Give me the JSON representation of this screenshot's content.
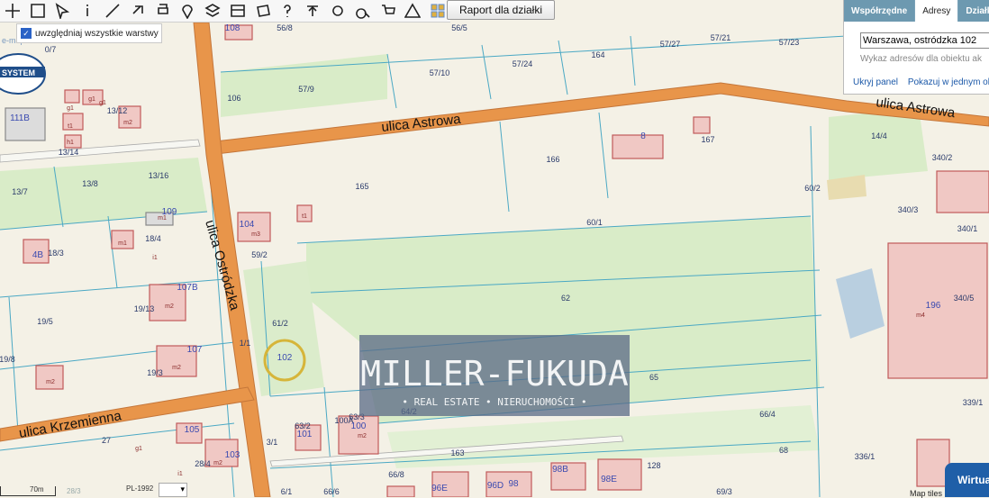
{
  "toolbar": {
    "tools": [
      "pan-icon",
      "zoom-extent-icon",
      "select-icon",
      "info-icon",
      "measure-icon",
      "link-icon",
      "print-icon",
      "location-pin-icon",
      "layers-icon",
      "layout-icon",
      "shape-icon",
      "help-icon",
      "upload-icon",
      "settings-icon",
      "search-map-icon",
      "cart-icon",
      "warning-icon",
      "color-grid-icon"
    ]
  },
  "report_button": "Raport dla działki",
  "layers_toggle": {
    "label": "uwzględniaj wszystkie warstwy",
    "checked": true
  },
  "side_panel": {
    "tabs": [
      "Współrzędne",
      "Adresy",
      "Działki"
    ],
    "active_tab": "Adresy",
    "address_value": "Warszawa, ostródzka 102",
    "hint": "Wykaz adresów dla obiektu ak",
    "links": [
      "Ukryj panel",
      "Pokazuj w jednym ok"
    ]
  },
  "watermark": {
    "brand": "MILLER-FUKUDA",
    "tagline": "• REAL ESTATE • NIERUCHOMOŚCI •"
  },
  "streets": [
    "ulica Astrowa",
    "ulica Astrowa",
    "ulica Ostródzka",
    "ulica Krzemienna"
  ],
  "streets_top_left": "",
  "logo_text": "SYSTEM",
  "logo_sub": "e-mapa.net",
  "parcels": [
    "56/8",
    "56/5",
    "57/27",
    "57/21",
    "57/23",
    "57/9",
    "57/10",
    "57/24",
    "164",
    "106",
    "13/12",
    "13/14",
    "165",
    "166",
    "167",
    "14/4",
    "340/2",
    "13/7",
    "13/8",
    "13/16",
    "60/2",
    "340/3",
    "60/1",
    "340/1",
    "18/3",
    "18/4",
    "59/2",
    "19/5",
    "19/13",
    "62",
    "340/5",
    "61/2",
    "19/8",
    "19/3",
    "65",
    "64/2",
    "66/4",
    "339/1",
    "27",
    "63/2",
    "63/3",
    "100A",
    "163",
    "68",
    "336/1",
    "28/4",
    "66/8",
    "128",
    "69/3",
    "66/6",
    "0/7",
    "1/1",
    "3/1",
    "6/1"
  ],
  "buildings": [
    "108",
    "109",
    "104",
    "107B",
    "107",
    "105",
    "103",
    "101",
    "102",
    "100",
    "111B",
    "8",
    "4B",
    "196",
    "98B",
    "98E",
    "96E",
    "96D",
    "98"
  ],
  "building_codes": [
    "g1",
    "g1",
    "g1",
    "m2",
    "t1",
    "h1",
    "m1",
    "m3",
    "t1",
    "m1",
    "i1",
    "m2",
    "m2",
    "m2",
    "g1",
    "m2",
    "m2",
    "m4",
    "i1"
  ],
  "scale": {
    "label": "70m",
    "label2": "28/3",
    "crs": "PL-1992"
  },
  "map_tiles": "Map tiles",
  "wirtual_button": "Wirtua",
  "colors": {
    "road": "#e8954a",
    "road_edge": "#c4763a",
    "green": "#d9ecc8",
    "parcel_line": "#4aa8c4",
    "building": "#f0c8c4",
    "building_edge": "#c05a5a",
    "label": "#2a3a8a",
    "highlight": "#d6b53a",
    "panel_tab": "#5f8fa8"
  }
}
